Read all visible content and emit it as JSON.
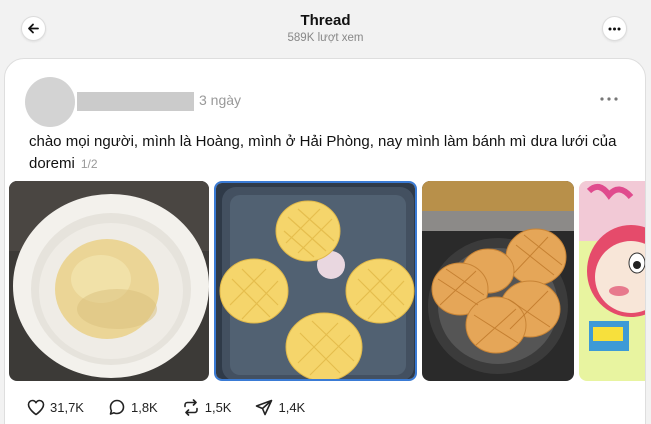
{
  "header": {
    "title": "Thread",
    "views": "589K lượt xem"
  },
  "post": {
    "time": "3 ngày",
    "text": "chào mọi người, mình là Hoàng, mình ở Hải Phòng, nay mình làm bánh mì dưa lưới của doremi",
    "page_indicator": "1/2",
    "images": [
      {
        "name": "dough-bowl"
      },
      {
        "name": "buns-in-glass-tray"
      },
      {
        "name": "baked-buns-air-fryer"
      },
      {
        "name": "doraemon-character"
      }
    ]
  },
  "actions": {
    "likes": "31,7K",
    "comments": "1,8K",
    "reposts": "1,5K",
    "shares": "1,4K"
  },
  "colors": {
    "background": "#f2f2f2",
    "card": "#ffffff",
    "muted_text": "#999999"
  }
}
